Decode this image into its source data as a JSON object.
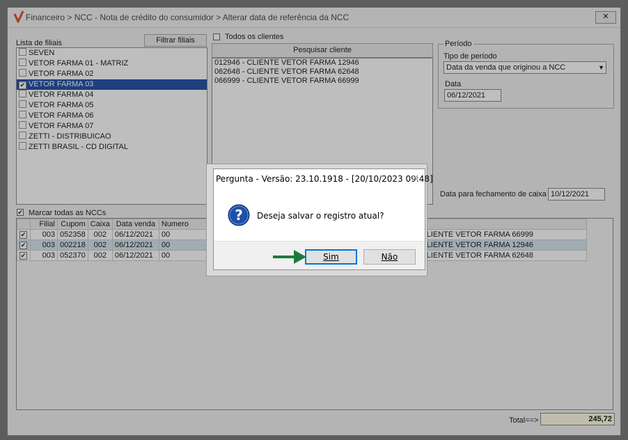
{
  "window": {
    "title": "Financeiro > NCC - Nota de crédito do consumidor > Alterar data de referência da NCC",
    "close_label": "✕"
  },
  "filiais": {
    "label": "Lista de filiais",
    "filter_button": "Filtrar filiais",
    "items": [
      {
        "label": "SEVEN",
        "checked": false,
        "selected": false
      },
      {
        "label": "VETOR FARMA 01 - MATRIZ",
        "checked": false,
        "selected": false
      },
      {
        "label": "VETOR FARMA 02",
        "checked": false,
        "selected": false
      },
      {
        "label": "VETOR FARMA 03",
        "checked": true,
        "selected": true
      },
      {
        "label": "VETOR FARMA 04",
        "checked": false,
        "selected": false
      },
      {
        "label": "VETOR FARMA 05",
        "checked": false,
        "selected": false
      },
      {
        "label": "VETOR FARMA 06",
        "checked": false,
        "selected": false
      },
      {
        "label": "VETOR FARMA 07",
        "checked": false,
        "selected": false
      },
      {
        "label": "ZETTI - DISTRIBUICAO",
        "checked": false,
        "selected": false
      },
      {
        "label": "ZETTI BRASIL - CD DIGITAL",
        "checked": false,
        "selected": false
      }
    ]
  },
  "clientes": {
    "all_label": "Todos os clientes",
    "search_button": "Pesquisar cliente",
    "items": [
      "012946 - CLIENTE VETOR FARMA 12946",
      "062648 - CLIENTE VETOR FARMA 62648",
      "066999 - CLIENTE VETOR FARMA 66999"
    ]
  },
  "periodo": {
    "legend": "Período",
    "tipo_label": "Tipo de período",
    "tipo_value": "Data da venda que originou a NCC",
    "data_label": "Data",
    "data_value": "06/12/2021"
  },
  "fechamento": {
    "label": "Data para fechamento de caixa",
    "value": "10/12/2021"
  },
  "marcar_todas": "Marcar todas as NCCs",
  "grid": {
    "headers": [
      "",
      "Filial",
      "Cupom",
      "Caixa",
      "Data venda",
      "Numero"
    ],
    "rows": [
      {
        "filial": "003",
        "cupom": "052358",
        "caixa": "002",
        "data": "06/12/2021",
        "numero": "00",
        "cliente": "9 - CLIENTE VETOR FARMA 66999",
        "highlight": false
      },
      {
        "filial": "003",
        "cupom": "002218",
        "caixa": "002",
        "data": "06/12/2021",
        "numero": "00",
        "cliente": "6 - CLIENTE VETOR FARMA 12946",
        "highlight": true
      },
      {
        "filial": "003",
        "cupom": "052370",
        "caixa": "002",
        "data": "06/12/2021",
        "numero": "00",
        "cliente": "8 - CLIENTE VETOR FARMA 62648",
        "highlight": false
      }
    ],
    "cliente_header_tail": "e"
  },
  "total": {
    "label": "Total==>",
    "value": "245,72"
  },
  "dialog": {
    "title": "Pergunta - Versão: 23.10.1918 - [20/10/2023 09:48]",
    "close": "✕",
    "message": "Deseja salvar o registro atual?",
    "yes_label": "Sim",
    "no_label": "Não"
  },
  "colors": {
    "selection": "#0a3d9e",
    "highlight_row": "#cfe3ee",
    "total_bg": "#ffffe0",
    "arrow": "#1f7a3e",
    "question_icon": "#1e4fa8"
  }
}
